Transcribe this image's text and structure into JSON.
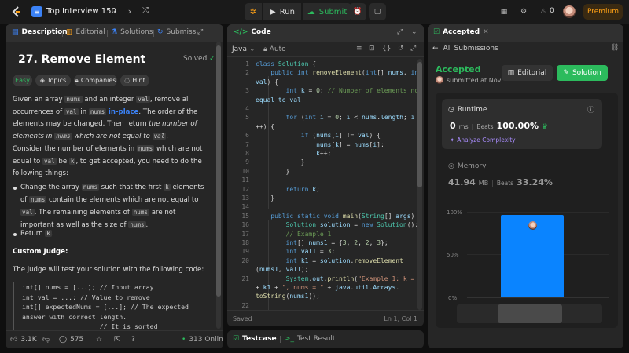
{
  "topbar": {
    "title": "Top Interview 150",
    "run_label": "Run",
    "submit_label": "Submit",
    "streak_count": "0",
    "premium_label": "Premium"
  },
  "description": {
    "tabs": [
      "Description",
      "Editorial",
      "Solutions",
      "Submissi"
    ],
    "title": "27. Remove Element",
    "solved_label": "Solved",
    "chips": [
      "Easy",
      "Topics",
      "Companies",
      "Hint"
    ],
    "p1": {
      "a": "Given an array ",
      "c1": "nums",
      "b": " and an integer ",
      "c2": "val",
      "c": ", remove all occurrences of ",
      "c3": "val",
      "d": " in ",
      "c4": "nums",
      "e": " ",
      "hl": "in-place",
      "f": ". The order of the elements may be changed. Then return ",
      "g": "the number of elements in ",
      "c5": "nums",
      "h": " which are not equal to ",
      "c6": "val",
      "i": "."
    },
    "p2": {
      "a": "Consider the number of elements in ",
      "c1": "nums",
      "b": " which are not equal to ",
      "c2": "val",
      "c": " be ",
      "c3": "k",
      "d": ", to get accepted, you need to do the following things:"
    },
    "b1": {
      "a": "Change the array ",
      "c1": "nums",
      "b": " such that the first ",
      "c2": "k",
      "c": " elements of ",
      "c3": "nums",
      "d": " contain the elements which are not equal to ",
      "c4": "val",
      "e": ". The remaining elements of ",
      "c5": "nums",
      "f": " are not important as well as the size of ",
      "c6": "nums",
      "g": "."
    },
    "b2": {
      "a": "Return ",
      "c1": "k",
      "b": "."
    },
    "custom_judge_heading": "Custom Judge:",
    "judge_text": "The judge will test your solution with the following code:",
    "judge_code": [
      "int[] nums = [...]; // Input array",
      "int val = ...; // Value to remove",
      "int[] expectedNums = [...]; // The expected",
      "answer with correct length.",
      "                    // It is sorted"
    ],
    "likes": "3.1K",
    "comments": "575",
    "online": "313 Online"
  },
  "code": {
    "tab_label": "Code",
    "language": "Java",
    "mode": "Auto",
    "lines": [
      {
        "n": "1",
        "t": "class Solution {"
      },
      {
        "n": "2",
        "t": "    public int removeElement(int[] nums, int"
      },
      {
        "n": "",
        "t": "val) {"
      },
      {
        "n": "3",
        "t": "        int k = 0; // Number of elements not"
      },
      {
        "n": "",
        "t": "equal to val"
      },
      {
        "n": "4",
        "t": ""
      },
      {
        "n": "5",
        "t": "        for (int i = 0; i < nums.length; i"
      },
      {
        "n": "",
        "t": "++) {"
      },
      {
        "n": "6",
        "t": "            if (nums[i] != val) {"
      },
      {
        "n": "7",
        "t": "                nums[k] = nums[i];"
      },
      {
        "n": "8",
        "t": "                k++;"
      },
      {
        "n": "9",
        "t": "            }"
      },
      {
        "n": "10",
        "t": "        }"
      },
      {
        "n": "11",
        "t": ""
      },
      {
        "n": "12",
        "t": "        return k;"
      },
      {
        "n": "13",
        "t": "    }"
      },
      {
        "n": "14",
        "t": ""
      },
      {
        "n": "15",
        "t": "    public static void main(String[] args) {"
      },
      {
        "n": "16",
        "t": "        Solution solution = new Solution();"
      },
      {
        "n": "17",
        "t": "        // Example 1"
      },
      {
        "n": "18",
        "t": "        int[] nums1 = {3, 2, 2, 3};"
      },
      {
        "n": "19",
        "t": "        int val1 = 3;"
      },
      {
        "n": "20",
        "t": "        int k1 = solution.removeElement"
      },
      {
        "n": "",
        "t": "(nums1, val1);"
      },
      {
        "n": "21",
        "t": "        System.out.println(\"Example 1: k = \""
      },
      {
        "n": "",
        "t": "+ k1 + \", nums = \" + java.util.Arrays."
      },
      {
        "n": "",
        "t": "toString(nums1));"
      },
      {
        "n": "22",
        "t": ""
      }
    ],
    "status": "Saved",
    "cursor": "Ln 1, Col 1",
    "testcase_label": "Testcase",
    "testresult_label": "Test Result"
  },
  "accepted": {
    "tab_label": "Accepted",
    "all_submissions": "All Submissions",
    "status": "Accepted",
    "submitted": "submitted at Nov",
    "editorial_label": "Editorial",
    "solution_label": "Solution",
    "runtime_label": "Runtime",
    "runtime_value": "0",
    "runtime_unit": "ms",
    "beats_label": "Beats",
    "runtime_beats": "100.00%",
    "analyze_label": "Analyze Complexity",
    "memory_label": "Memory",
    "memory_value": "41.94",
    "memory_unit": "MB",
    "memory_beats": "33.24%",
    "axis_labels": [
      "100%",
      "50%",
      "0%"
    ],
    "bar_level": 0.96
  },
  "colors": {
    "accent": "#2cbb5d",
    "brand": "#ffa116",
    "link": "#3b82f6"
  }
}
